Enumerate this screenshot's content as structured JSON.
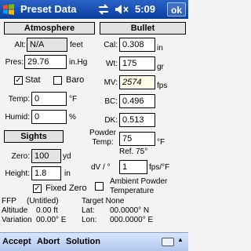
{
  "titlebar": {
    "title": "Preset Data",
    "time": "5:09",
    "ok": "ok"
  },
  "atmosphere": {
    "header": "Atmosphere",
    "alt_label": "Alt:",
    "alt_value": "N/A",
    "alt_unit": "feet",
    "pres_label": "Pres:",
    "pres_value": "29.76",
    "pres_unit": "in.Hg",
    "stat_label": "Stat",
    "stat_checked": true,
    "baro_label": "Baro",
    "baro_checked": false,
    "temp_label": "Temp:",
    "temp_value": "0",
    "temp_unit": "°F",
    "humid_label": "Humid:",
    "humid_value": "0",
    "humid_unit": "%"
  },
  "bullet": {
    "header": "Bullet",
    "cal_label": "Cal:",
    "cal_value": "0.308",
    "cal_unit": "in",
    "wt_label": "Wt:",
    "wt_value": "175",
    "wt_unit": "gr",
    "mv_label": "MV:",
    "mv_value": "2574",
    "mv_unit": "fps",
    "bc_label": "BC:",
    "bc_value": "0.496",
    "dk_label": "DK:",
    "dk_value": "0.513",
    "powder_label_1": "Powder",
    "powder_label_2": "Temp:",
    "powder_value": "75",
    "powder_unit": "°F",
    "ref_text": "Ref.  75°",
    "dv_label": "dV / °",
    "dv_value": "1",
    "dv_unit": "fps/°F",
    "ambient_label_1": "Ambient Powder",
    "ambient_label_2": "Temperature",
    "ambient_checked": false
  },
  "sights": {
    "header": "Sights",
    "zero_label": "Zero:",
    "zero_value": "100",
    "zero_unit": "yd",
    "height_label": "Height:",
    "height_value": "1.8",
    "height_unit": "in",
    "fixed_zero_label": "Fixed Zero",
    "fixed_zero_checked": true
  },
  "info": {
    "ffp": "FFP",
    "untitled": "(Untitled)",
    "target": "Target None",
    "altitude_label": "Altitude",
    "altitude_value": "0.00 ft",
    "lat_label": "Lat:",
    "lat_value": "00.0000° N",
    "variation_label": "Variation",
    "variation_value": "00.00° E",
    "lon_label": "Lon:",
    "lon_value": "000.0000° E"
  },
  "menubar": {
    "accept": "Accept",
    "abort": "Abort",
    "solution": "Solution"
  }
}
